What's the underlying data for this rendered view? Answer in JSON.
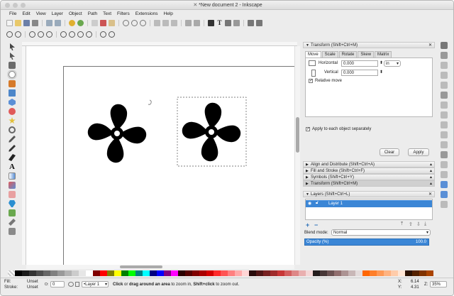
{
  "window": {
    "title": "*New document 2 - Inkscape"
  },
  "menu": [
    "File",
    "Edit",
    "View",
    "Layer",
    "Object",
    "Path",
    "Text",
    "Filters",
    "Extensions",
    "Help"
  ],
  "canvas": {
    "objects": [
      {
        "name": "pinwheel-left",
        "selected": false
      },
      {
        "name": "pinwheel-right",
        "selected": true
      }
    ]
  },
  "transform_panel": {
    "title": "Transform (Shift+Ctrl+M)",
    "tabs": [
      "Move",
      "Scale",
      "Rotate",
      "Skew",
      "Matrix"
    ],
    "active_tab": "Move",
    "horizontal_label": "Horizontal",
    "horizontal_value": "0.000",
    "vertical_label": "Vertical",
    "vertical_value": "0.000",
    "unit": "in",
    "relative_move_label": "Relative move",
    "apply_each_label": "Apply to each object separately",
    "clear_label": "Clear",
    "apply_label": "Apply"
  },
  "collapsed_docks": [
    "Align and Distribute (Shift+Ctrl+A)",
    "Fill and Stroke (Shift+Ctrl+F)",
    "Symbols (Shift+Ctrl+Y)",
    "Transform (Shift+Ctrl+M)"
  ],
  "layers_panel": {
    "title": "Layers (Shift+Ctrl+L)",
    "layer_name": "Layer 1",
    "blend_label": "Blend mode:",
    "blend_value": "Normal",
    "opacity_label": "Opacity (%)",
    "opacity_value": "100.0"
  },
  "status": {
    "fill_label": "Fill:",
    "fill_value": "Unset",
    "stroke_label": "Stroke:",
    "stroke_value": "Unset",
    "opacity_value": "0",
    "layer_value": "•Layer 1",
    "message_bold1": "Click",
    "message_mid1": " or ",
    "message_bold2": "drag around an area",
    "message_mid2": " to zoom in, ",
    "message_bold3": "Shift+click",
    "message_end": " to zoom out.",
    "x_label": "X:",
    "x_value": "6.14",
    "y_label": "Y:",
    "y_value": "4.31",
    "z_label": "Z:",
    "z_value": "35%"
  },
  "colors": {
    "accent": "#3b86d6",
    "selection_bar": "#3b86d6"
  }
}
